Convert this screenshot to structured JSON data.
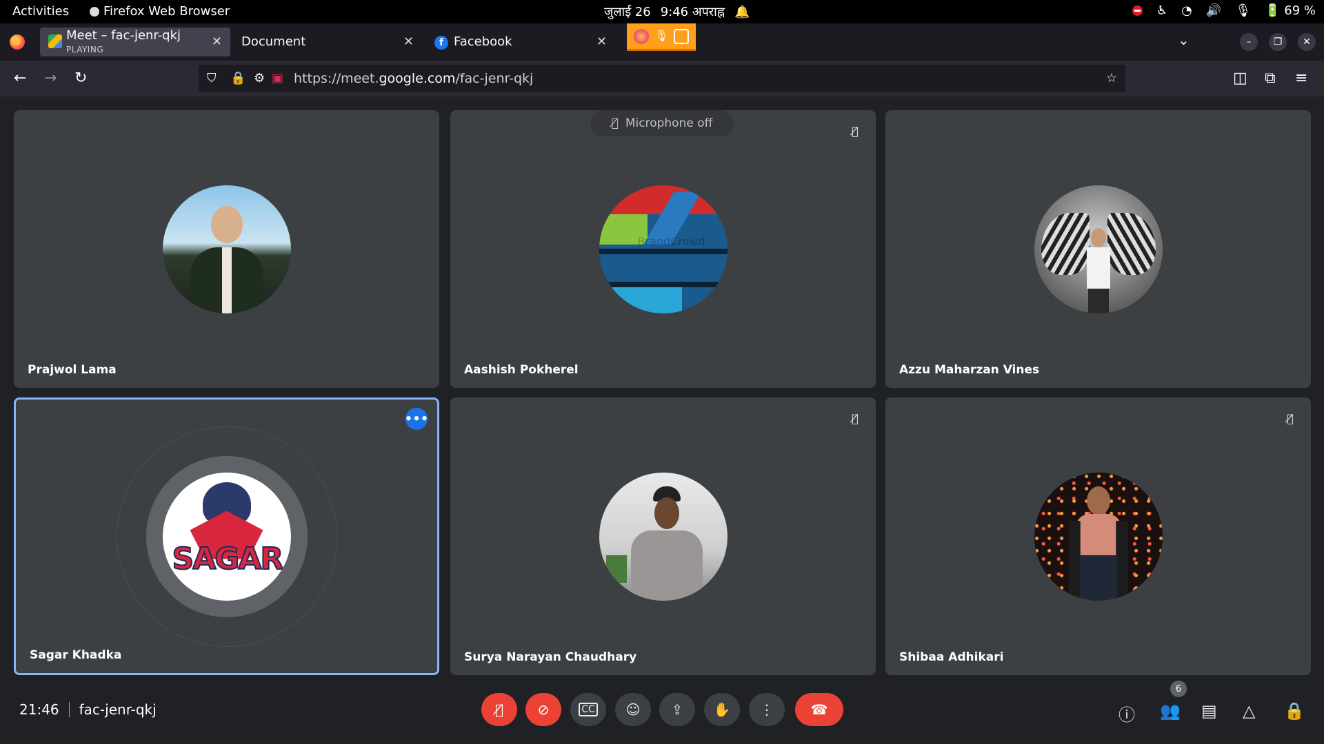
{
  "system_bar": {
    "activities": "Activities",
    "app_name": "Firefox Web Browser",
    "date": "जुलाई 26",
    "time": "9:46 अपराह्न",
    "battery": "69 %"
  },
  "browser": {
    "tabs": [
      {
        "title": "Meet – fac-jenr-qkj",
        "sub": "PLAYING",
        "active": true
      },
      {
        "title": "Document",
        "active": false
      },
      {
        "title": "Facebook",
        "active": false
      }
    ],
    "url_prefix": "https://meet.",
    "url_domain": "google.com",
    "url_path": "/fac-jenr-qkj"
  },
  "meet": {
    "toast": "Microphone off",
    "participants": [
      {
        "name": "Prajwol Lama",
        "muted": false
      },
      {
        "name": "Aashish Pokherel",
        "muted": true
      },
      {
        "name": "Azzu Maharzan Vines",
        "muted": false
      },
      {
        "name": "Sagar Khadka",
        "muted": false,
        "speaking": true,
        "avatar_text": "SAGAR"
      },
      {
        "name": "Surya Narayan Chaudhary",
        "muted": true
      },
      {
        "name": "Shibaa Adhikari",
        "muted": true
      }
    ],
    "avatar_watermark": "BrandCrowd",
    "clock": "21:46",
    "meeting_code": "fac-jenr-qkj",
    "participant_count": "6"
  },
  "icons": {
    "mic_off": "mic-off-icon",
    "camera_off": "camera-off-icon",
    "captions": "captions-icon",
    "emoji": "emoji-icon",
    "present": "present-icon",
    "raise_hand": "raise-hand-icon",
    "more": "more-options-icon",
    "end_call": "end-call-icon"
  },
  "colors": {
    "red": "#ea4335",
    "speaking_border": "#8ab4f8",
    "tile": "#3c4043",
    "background": "#202124"
  }
}
